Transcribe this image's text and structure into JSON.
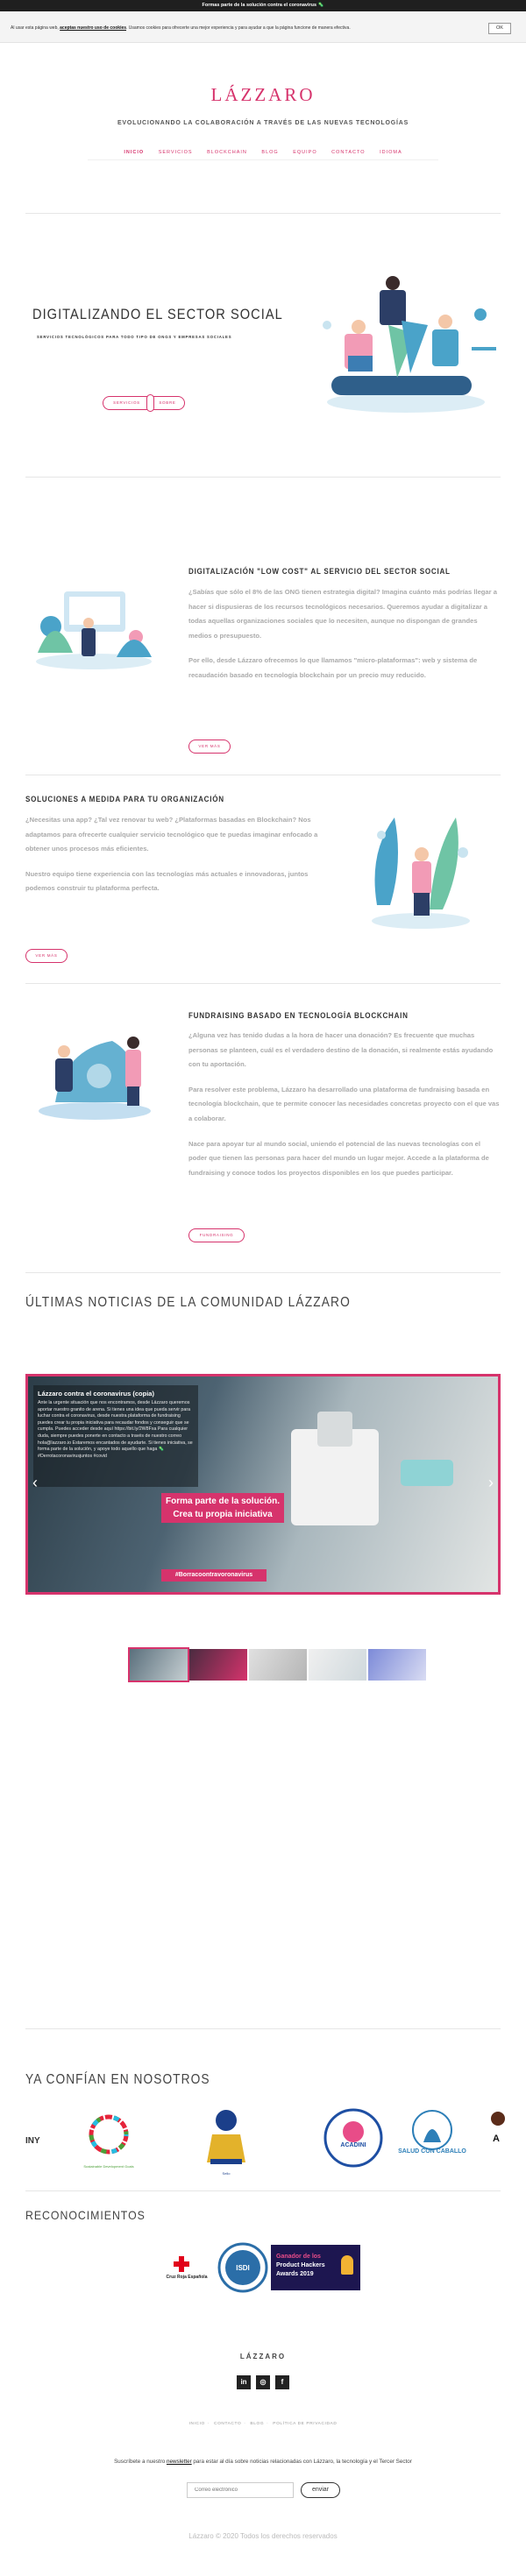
{
  "topbar": {
    "text": "Formas parte de la solución contra el coronavirus 🦠"
  },
  "cookie": {
    "text_before": "Al usar esta página web, ",
    "link": "aceptas nuestro uso de cookies",
    "text_after": ". Usamos cookies para ofrecerte una mejor experiencia y para ayudar a que la página funcione de manera efectiva.",
    "ok": "OK"
  },
  "header": {
    "logo": "LÁZZARO",
    "tagline": "EVOLUCIONANDO LA COLABORACIÓN A TRAVÉS DE LAS NUEVAS TECNOLOGÍAS",
    "nav": [
      "INICIO",
      "SERVICIOS",
      "BLOCKCHAIN",
      "BLOG",
      "EQUIPO",
      "CONTACTO",
      "IDIOMA"
    ]
  },
  "hero": {
    "title": "DIGITALIZANDO EL SECTOR SOCIAL",
    "subtitle": "SERVICIOS TECNOLÓGICOS PARA TODO TIPO DE ONGS Y EMPRESAS SOCIALES",
    "btn_left": "SERVICIOS",
    "btn_right": "SOBRE"
  },
  "section1": {
    "title": "DIGITALIZACIÓN \"LOW COST\" AL SERVICIO DEL SECTOR SOCIAL",
    "p1": "¿Sabías que sólo el 8% de las ONG tienen estrategia digital? Imagina cuánto más podrías llegar a hacer si dispusieras de los recursos tecnológicos necesarios. Queremos ayudar a digitalizar a todas aquellas organizaciones sociales que lo necesiten, aunque no dispongan de grandes medios o presupuesto.",
    "p2": "Por ello, desde Lázzaro ofrecemos lo que llamamos \"micro-plataformas\": web y sistema de recaudación basado en tecnología blockchain por un precio muy reducido.",
    "btn": "VER MÁS"
  },
  "section2": {
    "title": "SOLUCIONES A MEDIDA PARA TU ORGANIZACIÓN",
    "p1": "¿Necesitas una app? ¿Tal vez renovar tu web? ¿Plataformas basadas en Blockchain? Nos adaptamos para ofrecerte cualquier servicio tecnológico que te puedas imaginar enfocado a obtener unos procesos más eficientes.",
    "p2": "Nuestro equipo tiene experiencia con las tecnologías más actuales e innovadoras, juntos podemos construir tu plataforma perfecta.",
    "btn": "VER MÁS"
  },
  "section3": {
    "title": "FUNDRAISING BASADO EN TECNOLOGÍA BLOCKCHAIN",
    "p1": "¿Alguna vez has tenido dudas a la hora de hacer una donación? Es frecuente que muchas personas se planteen, cuál es el verdadero destino de la donación, si realmente estás ayudando con tu aportación.",
    "p2": "Para resolver este problema, Lázzaro ha desarrollado una plataforma de fundraising basada en tecnología blockchain, que te permite conocer las necesidades concretas proyecto con el que vas a colaborar.",
    "p3": "Nace para apoyar tur al mundo social, uniendo el potencial de las nuevas tecnologías con el poder que tienen las personas para hacer del mundo un lugar mejor. Accede a la plataforma de fundraising y conoce todos los proyectos disponibles en los que puedes participar.",
    "btn": "FUNDRAISING"
  },
  "news": {
    "title": "ÚLTIMAS NOTICIAS DE LA COMUNIDAD LÁZZARO",
    "card_title": "Lázzaro contra el coronavirus (copia)",
    "card_text": "Ante la urgente situación que nos encontramos, desde Lázzaro queremos aportar nuestro granito de arena. Si tienes una idea que pueda servir para luchar contra el coronavirus, desde nuestra plataforma de fundraising puedes crear tu propia iniciativa para recaudar fondos y conseguir que se cumpla. Puedes acceder desde aquí https://bit.ly/2W8Fxa Para cualquier duda, siempre puedes ponerte en contacto a través de nuestro correo hola@lazzaro.io Estaremos encantados de ayudarte. Si tienes iniciativa, se forma parte de la solución, y apoye todo aquello que haga 🦠 #Derrotacoronavirusjuntos #covid",
    "banner_line1": "Forma parte de la solución.",
    "banner_line2": "Crea tu propia iniciativa",
    "hashtag": "#Borracoontravoronavirus",
    "prev": "‹",
    "next": "›"
  },
  "trust": {
    "title": "YA CONFÍAN EN NOSOTROS",
    "logo1": "INY",
    "logo2": "Sustainable Development Goals",
    "logo3": "Sello",
    "logo4": "ACADINI",
    "logo5": "SALUD CON CABALLO",
    "logo6": "A"
  },
  "recognitions": {
    "title": "RECONOCIMIENTOS",
    "r1": "Cruz Roja Española",
    "r2": "ISDI",
    "r3_line1": "Ganador de los",
    "r3_line2": "Product Hackers",
    "r3_line3": "Awards 2019"
  },
  "footer": {
    "logo": "LÁZZARO",
    "social": [
      "in",
      "◎",
      "f"
    ],
    "links": [
      "INICIO",
      "CONTACTO",
      "BLOG",
      "POLÍTICA DE PRIVACIDAD"
    ],
    "newsletter_before": "Suscríbete a nuestro ",
    "newsletter_link": "newsletter",
    "newsletter_after": " para estar al día sobre noticias relacionadas con Lázzaro, la tecnología y el Tercer Sector",
    "email_placeholder": "Correo electrónico",
    "send": "enviar",
    "copyright": "Lázzaro © 2020 Todos los derechos reservados"
  },
  "colors": {
    "accent": "#d6336c",
    "dark": "#1f1f1f",
    "blue": "#4aa3c9"
  }
}
